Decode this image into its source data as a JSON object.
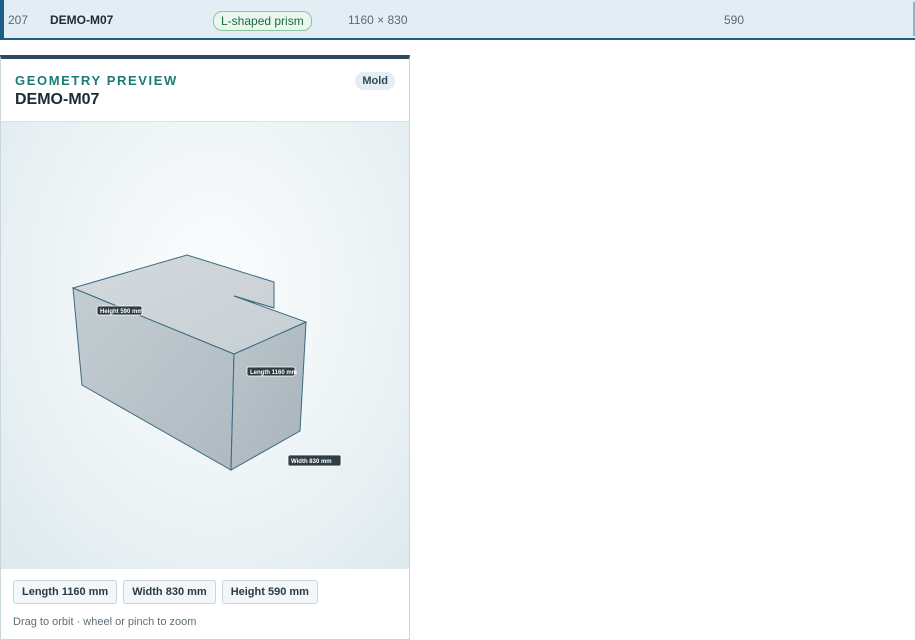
{
  "row": {
    "id": "207",
    "code": "DEMO-M07",
    "shape": "L-shaped prism",
    "dims": "1160 × 830",
    "height": "590"
  },
  "preview": {
    "eyebrow": "GEOMETRY PREVIEW",
    "title": "DEMO-M07",
    "badge": "Mold",
    "labels": {
      "height": "Height 590 mm",
      "length": "Length 1160 mm",
      "width": "Width 830 mm"
    },
    "chips": {
      "length": "Length 1160 mm",
      "width": "Width 830 mm",
      "height": "Height 590 mm"
    },
    "hint": "Drag to orbit · wheel or pinch to zoom"
  },
  "colors": {
    "accent": "#1d7a73",
    "selection": "#1d5e86",
    "shape_badge_bg": "#eaf7ee",
    "shape_badge_border": "#86c79b",
    "solid_top": "#cdd5d9",
    "solid_side": "#b5c0c6",
    "solid_edge": "#3a6a80"
  }
}
